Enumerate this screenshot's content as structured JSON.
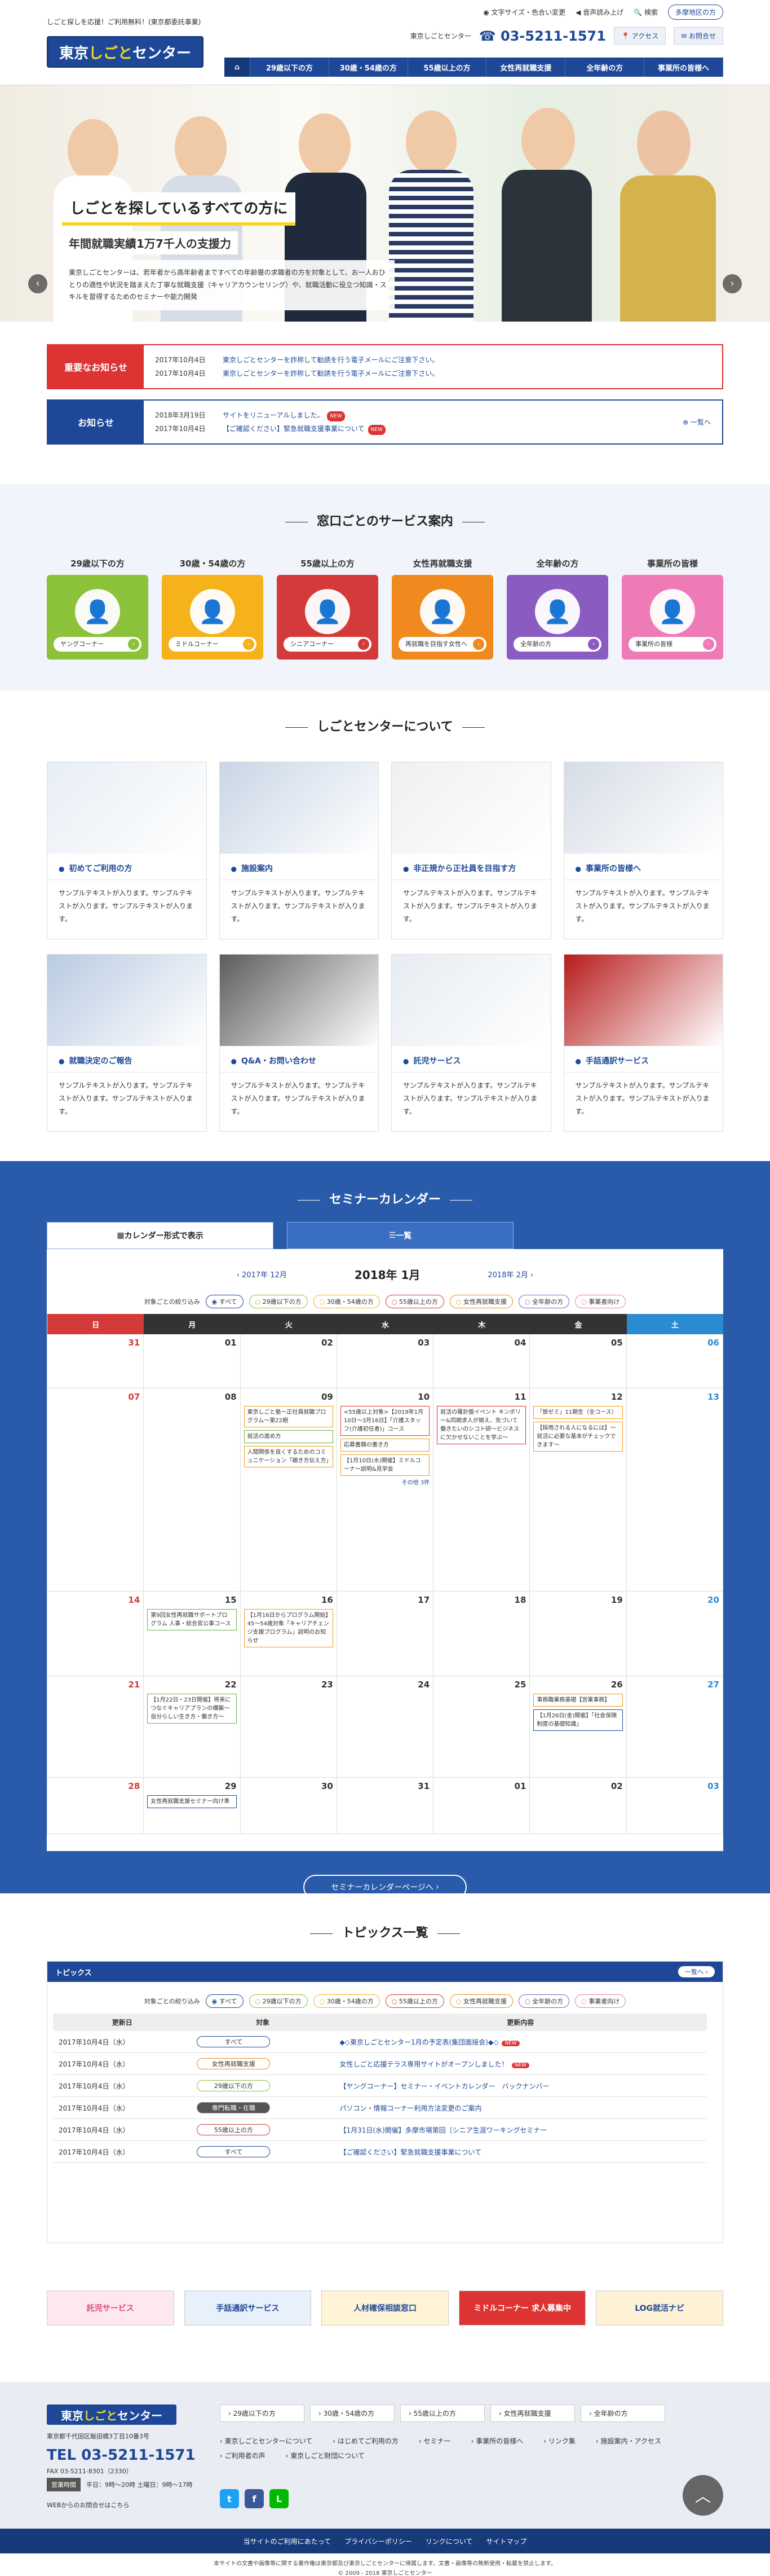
{
  "header": {
    "tagline": "しごと探しを応援！ご利用無料！(東京都委託事業)",
    "logo_pre": "東京",
    "logo_mid": "しごと",
    "logo_post": "センター",
    "font_size": "文字サイズ・色合い変更",
    "voice": "音声読み上げ",
    "search": "検索",
    "area": "多摩地区の方",
    "tel_label": "東京しごとセンター",
    "tel": "03-5211-1571",
    "access": "アクセス",
    "contact": "お問合せ",
    "nav": [
      "29歳以下の方",
      "30歳・54歳の方",
      "55歳以上の方",
      "女性再就職支援",
      "全年齢の方",
      "事業所の皆様へ"
    ]
  },
  "hero": {
    "title": "しごとを探しているすべての方に",
    "sub": "年間就職実績1万7千人の支援力",
    "text": "東京しごとセンターは、若年者から高年齢者まですべての年齢層の求職者の方を対象として、お一人おひとりの適性や状況を踏まえた丁寧な就職支援（キャリアカウンセリング）や、就職活動に役立つ知識・スキルを習得するためのセミナーや能力開発"
  },
  "important": {
    "label": "重要なお知らせ",
    "items": [
      {
        "date": "2017年10月4日",
        "text": "東京しごとセンターを詐称して勧誘を行う電子メールにご注意下さい。"
      },
      {
        "date": "2017年10月4日",
        "text": "東京しごとセンターを詐称して勧誘を行う電子メールにご注意下さい。"
      }
    ]
  },
  "news": {
    "label": "お知らせ",
    "more": "一覧へ",
    "items": [
      {
        "date": "2018年3月19日",
        "text": "サイトをリニューアルしました。",
        "new": "NEW"
      },
      {
        "date": "2017年10月4日",
        "text": "【ご確認ください】緊急就職支援事業について",
        "new": "NEW"
      }
    ]
  },
  "service": {
    "title": "窓口ごとのサービス案内",
    "items": [
      {
        "t": "29歳以下の方",
        "l": "ヤングコーナー",
        "c": "#8cc13a"
      },
      {
        "t": "30歳・54歳の方",
        "l": "ミドルコーナー",
        "c": "#f5b21a"
      },
      {
        "t": "55歳以上の方",
        "l": "シニアコーナー",
        "c": "#d43a3a"
      },
      {
        "t": "女性再就職支援",
        "l": "再就職を目指す女性へ",
        "c": "#f08a1e"
      },
      {
        "t": "全年齢の方",
        "l": "全年齢の方",
        "c": "#8a5cc2"
      },
      {
        "t": "事業所の皆様",
        "l": "事業所の皆様",
        "c": "#ef7bb6"
      }
    ]
  },
  "about": {
    "title": "しごとセンターについて",
    "cards": [
      {
        "t": "初めてご利用の方",
        "x": "サンプルテキストが入ります。サンプルテキストが入ります。サンプルテキストが入ります。"
      },
      {
        "t": "施設案内",
        "x": "サンプルテキストが入ります。サンプルテキストが入ります。サンプルテキストが入ります。"
      },
      {
        "t": "非正規から正社員を目指す方",
        "x": "サンプルテキストが入ります。サンプルテキストが入ります。サンプルテキストが入ります。"
      },
      {
        "t": "事業所の皆様へ",
        "x": "サンプルテキストが入ります。サンプルテキストが入ります。サンプルテキストが入ります。"
      },
      {
        "t": "就職決定のご報告",
        "x": "サンプルテキストが入ります。サンプルテキストが入ります。サンプルテキストが入ります。"
      },
      {
        "t": "Q&A・お問い合わせ",
        "x": "サンプルテキストが入ります。サンプルテキストが入ります。サンプルテキストが入ります。"
      },
      {
        "t": "託児サービス",
        "x": "サンプルテキストが入ります。サンプルテキストが入ります。サンプルテキストが入ります。"
      },
      {
        "t": "手話通訳サービス",
        "x": "サンプルテキストが入ります。サンプルテキストが入ります。サンプルテキストが入ります。"
      }
    ]
  },
  "seminar": {
    "title": "セミナーカレンダー",
    "tab1": "カレンダー形式で表示",
    "tab2": "一覧",
    "prev": "2017年 12月",
    "cur": "2018年 1月",
    "next": "2018年 2月",
    "filter_label": "対象ごとの絞り込み",
    "filters": [
      "すべて",
      "29歳以下の方",
      "30歳・54歳の方",
      "55歳以上の方",
      "女性再就職支援",
      "全年齢の方",
      "事業者向け"
    ],
    "days": [
      "日",
      "月",
      "火",
      "水",
      "木",
      "金",
      "土"
    ],
    "weeks": [
      [
        {
          "d": "31"
        },
        {
          "d": "01"
        },
        {
          "d": "02"
        },
        {
          "d": "03"
        },
        {
          "d": "04"
        },
        {
          "d": "05"
        },
        {
          "d": "06"
        }
      ],
      [
        {
          "d": "07"
        },
        {
          "d": "08"
        },
        {
          "d": "09",
          "ev": [
            [
              "東京しごと塾〜正社員就職プログラム〜第22期",
              "o"
            ],
            [
              "就活の進め方",
              "g"
            ],
            [
              "人間関係を良くするためのコミュニケーション「聴き方伝え方」",
              "o"
            ]
          ]
        },
        {
          "d": "10",
          "ev": [
            [
              "<55歳以上対象>【2019年1月10日〜3月16日】「介護スタッフ(介護初任者)」コース",
              "r"
            ],
            [
              "応募書類の書き方",
              "o"
            ],
            [
              "【1月10日(水)開催】ミドルコーナー説明&見学会",
              "o"
            ]
          ],
          "more": "その他 3件"
        },
        {
          "d": "11",
          "ev": [
            [
              "就活の羅針盤イベント キンボリー&同期求人が揃え、気づいて働きたいのシコト研〜ビジネスに欠かせないことを学ぶ〜",
              "r"
            ]
          ]
        },
        {
          "d": "12",
          "ev": [
            [
              "「旅ゼミ」11期生（全コース）",
              "o"
            ],
            [
              "【採用される人になるには】〜就活に必要な基本がチェックできます〜",
              "o"
            ]
          ]
        },
        {
          "d": "13"
        }
      ],
      [
        {
          "d": "14"
        },
        {
          "d": "15",
          "ev": [
            [
              "第9回女性再就職サポートプログラム 人事・総合官公事コース",
              "g"
            ]
          ]
        },
        {
          "d": "16",
          "ev": [
            [
              "【1月16日からプログラム開始】45〜54歳対象「キャリアチェンジ支援プログラム」説明のお知らせ",
              "o"
            ]
          ]
        },
        {
          "d": "17"
        },
        {
          "d": "18"
        },
        {
          "d": "19"
        },
        {
          "d": "20"
        }
      ],
      [
        {
          "d": "21"
        },
        {
          "d": "22",
          "ev": [
            [
              "【1月22日・23日開催】将来につなぐキャリアプランの構築〜自分らしい生き方・働き方〜",
              "g"
            ]
          ]
        },
        {
          "d": "23"
        },
        {
          "d": "24"
        },
        {
          "d": "25"
        },
        {
          "d": "26",
          "ev": [
            [
              "事務職業務基礎【営業事務】",
              "o"
            ],
            [
              "【1月26日(金)開催】「社会保険制度の基礎知識」",
              "b"
            ]
          ]
        },
        {
          "d": "27"
        }
      ],
      [
        {
          "d": "28"
        },
        {
          "d": "29",
          "ev": [
            [
              "女性再就職支援セミナー向け準",
              "b"
            ]
          ]
        },
        {
          "d": "30"
        },
        {
          "d": "31"
        },
        {
          "d": "01"
        },
        {
          "d": "02"
        },
        {
          "d": "03"
        }
      ]
    ],
    "btn": "セミナーカレンダーページへ"
  },
  "topics": {
    "title": "トピックス一覧",
    "head": "トピックス",
    "more": "一覧へ",
    "cols": [
      "更新日",
      "対象",
      "更新内容"
    ],
    "rows": [
      [
        "2017年10月4日（水）",
        "すべて",
        "◆◇東京しごとセンター1月の予定表(集団面接会)◆◇"
      ],
      [
        "2017年10月4日（水）",
        "女性再就職支援",
        "女性しごと応援テラス専用サイトがオープンしました！"
      ],
      [
        "2017年10月4日（水）",
        "29歳以下の方",
        "【ヤングコーナー】セミナー・イベントカレンダー　バックナンバー"
      ],
      [
        "2017年10月4日（水）",
        "専門転職・在職",
        "パソコン・情報コーナー利用方法変更のご案内"
      ],
      [
        "2017年10月4日（水）",
        "55歳以上の方",
        "【1月31日(水)開催】多摩市場第回〔シニア生涯ワーキングセミナー"
      ],
      [
        "2017年10月4日（水）",
        "すべて",
        "【ご確認ください】緊急就職支援事業について"
      ]
    ]
  },
  "banners": [
    "託児サービス",
    "手話通訳サービス",
    "人材確保相談窓口",
    "ミドルコーナー 求人募集中",
    "LOG就活ナビ"
  ],
  "footer": {
    "address": "東京都千代田区飯田橋3丁目10番3号",
    "tel": "TEL 03-5211-1571",
    "fax": "FAX 03-5211-8301（2330）",
    "hours_label": "営業時間",
    "hours": "平日：9時〜20時 土曜日：9時〜17時",
    "web": "WEBからのお問合せはこちら",
    "links": [
      "29歳以下の方",
      "30歳・54歳の方",
      "55歳以上の方",
      "女性再就職支援",
      "全年齢の方"
    ],
    "links2": [
      "東京しごとセンターについて",
      "はじめてご利用の方",
      "セミナー",
      "事業所の皆様へ",
      "リンク集",
      "施設案内・アクセス",
      "ご利用者の声",
      "東京しごと財団について"
    ],
    "bottom": [
      "当サイトのご利用にあたって",
      "プライバシーポリシー",
      "リンクについて",
      "サイトマップ"
    ],
    "copy": "本サイトの文書や画像等に関する著作権は東京都及び東京しごとセンターに帰属します。文書・画像等の無断使用・転載を禁止します。",
    "copyright": "© 2009 - 2018 東京しごとセンター"
  }
}
